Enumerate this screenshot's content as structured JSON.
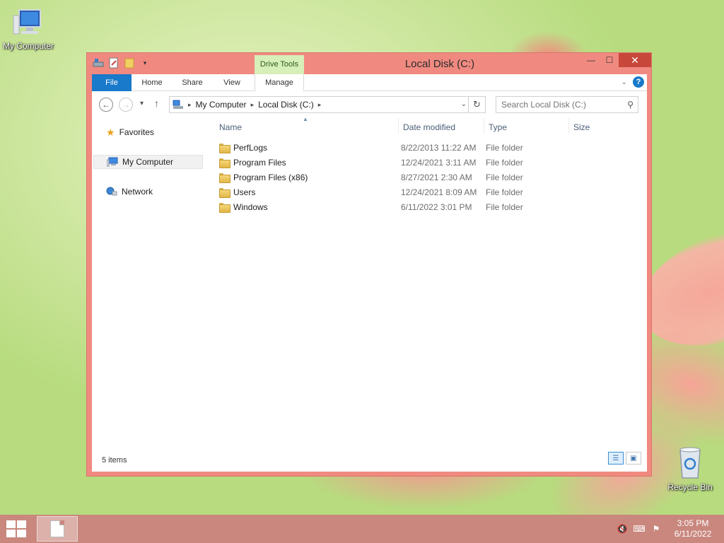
{
  "desktop": {
    "icons": [
      {
        "label": "My Computer"
      },
      {
        "label": "Recycle Bin"
      }
    ]
  },
  "window": {
    "title": "Local Disk (C:)",
    "context_tab": "Drive Tools",
    "controls": {
      "minimize": "—",
      "maximize": "☐",
      "close": "✕"
    }
  },
  "ribbon": {
    "tabs": [
      {
        "label": "File"
      },
      {
        "label": "Home"
      },
      {
        "label": "Share"
      },
      {
        "label": "View"
      },
      {
        "label": "Manage"
      }
    ]
  },
  "navbar": {
    "breadcrumb": [
      "My Computer",
      "Local Disk (C:)"
    ],
    "search_placeholder": "Search Local Disk (C:)"
  },
  "navpane": {
    "items": [
      {
        "label": "Favorites",
        "icon": "star-icon"
      },
      {
        "label": "My Computer",
        "icon": "computer-icon",
        "selected": true
      },
      {
        "label": "Network",
        "icon": "network-icon"
      }
    ]
  },
  "columns": {
    "name": "Name",
    "date": "Date modified",
    "type": "Type",
    "size": "Size"
  },
  "files": [
    {
      "name": "PerfLogs",
      "date": "8/22/2013 11:22 AM",
      "type": "File folder"
    },
    {
      "name": "Program Files",
      "date": "12/24/2021 3:11 AM",
      "type": "File folder"
    },
    {
      "name": "Program Files (x86)",
      "date": "8/27/2021 2:30 AM",
      "type": "File folder"
    },
    {
      "name": "Users",
      "date": "12/24/2021 8:09 AM",
      "type": "File folder"
    },
    {
      "name": "Windows",
      "date": "6/11/2022 3:01 PM",
      "type": "File folder"
    }
  ],
  "status": {
    "item_count": "5 items"
  },
  "taskbar": {
    "time": "3:05 PM",
    "date": "6/11/2022"
  }
}
